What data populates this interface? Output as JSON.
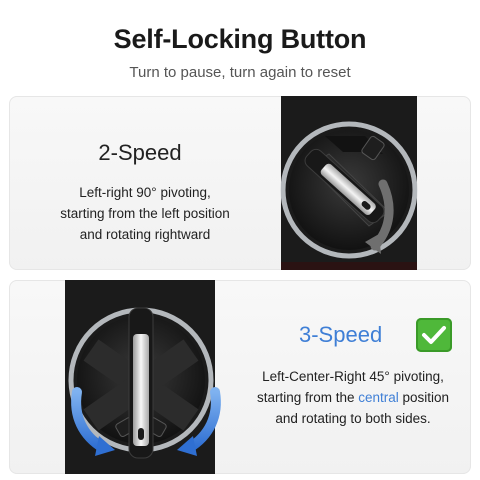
{
  "header": {
    "title": "Self-Locking Button",
    "subtitle": "Turn to pause, turn again to reset"
  },
  "cards": [
    {
      "heading": "2-Speed",
      "description": {
        "line1": "Left-right 90° pivoting,",
        "line2": "starting from the left position",
        "line3": "and rotating rightward"
      }
    },
    {
      "heading": "3-Speed",
      "description": {
        "line1": "Left-Center-Right 45° pivoting,",
        "line2_before": "starting from the ",
        "line2_highlight": "central",
        "line2_after": " position",
        "line3": "and rotating to both sides."
      }
    }
  ],
  "colors": {
    "accent_blue": "#3f7fd6",
    "check_green": "#4fb83a",
    "device_black": "#1b1b1b",
    "arrow_gray": "#6f6f6f"
  },
  "icons": [
    "check-mark-icon",
    "rotation-arrow-icon",
    "left-rotation-arrow-icon",
    "right-rotation-arrow-icon"
  ]
}
